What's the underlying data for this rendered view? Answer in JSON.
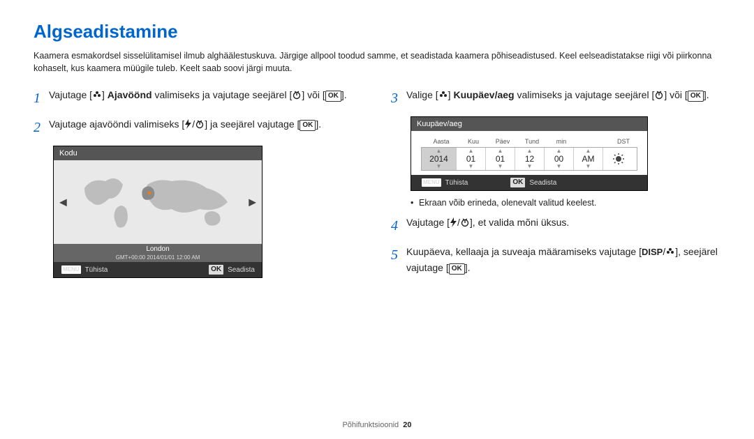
{
  "title": "Algseadistamine",
  "intro": "Kaamera esmakordsel sisselülitamisel ilmub alghäälestuskuva. Järgige allpool toodud samme, et seadistada kaamera põhiseadistused. Keel eelseadistatakse riigi või piirkonna kohaselt, kus kaamera müügile tuleb. Keelt saab soovi järgi muuta.",
  "steps": {
    "s1_a": "Vajutage [",
    "s1_b": "] ",
    "s1_bold": "Ajavöönd",
    "s1_c": " valimiseks ja vajutage seejärel [",
    "s1_d": "] või [",
    "s1_e": "].",
    "s2_a": "Vajutage ajavööndi valimiseks [",
    "s2_b": "] ja seejärel vajutage [",
    "s2_c": "].",
    "s3_a": "Valige [",
    "s3_b": "] ",
    "s3_bold": "Kuupäev/aeg",
    "s3_c": " valimiseks ja vajutage seejärel [",
    "s3_d": "] või [",
    "s3_e": "].",
    "s4_a": "Vajutage [",
    "s4_b": "], et valida mõni üksus.",
    "s5_a": "Kuupäeva, kellaaja ja suveaja määramiseks vajutage [",
    "s5_b": "], seejärel vajutage [",
    "s5_c": "]."
  },
  "mapPanel": {
    "title": "Kodu",
    "city": "London",
    "gmt": "GMT+00:00 2014/01/01 12:00 AM",
    "cancel": "Tühista",
    "set": "Seadista",
    "menu": "MENU",
    "ok": "OK"
  },
  "dtPanel": {
    "title": "Kuupäev/aeg",
    "labels": {
      "y": "Aasta",
      "m": "Kuu",
      "d": "Päev",
      "h": "Tund",
      "mi": "min",
      "dst": "DST"
    },
    "vals": {
      "y": "2014",
      "m": "01",
      "d": "01",
      "h": "12",
      "mi": "00",
      "ap": "AM"
    },
    "cancel": "Tühista",
    "set": "Seadista",
    "menu": "MENU",
    "ok": "OK"
  },
  "note": "Ekraan võib erineda, olenevalt valitud keelest.",
  "footer": {
    "section": "Põhifunktsioonid",
    "page": "20"
  },
  "glyphs": {
    "ok": "OK",
    "menu": "MENU",
    "disp": "DISP",
    "slash": "/",
    "lbr": "[",
    "rbr": "]"
  }
}
